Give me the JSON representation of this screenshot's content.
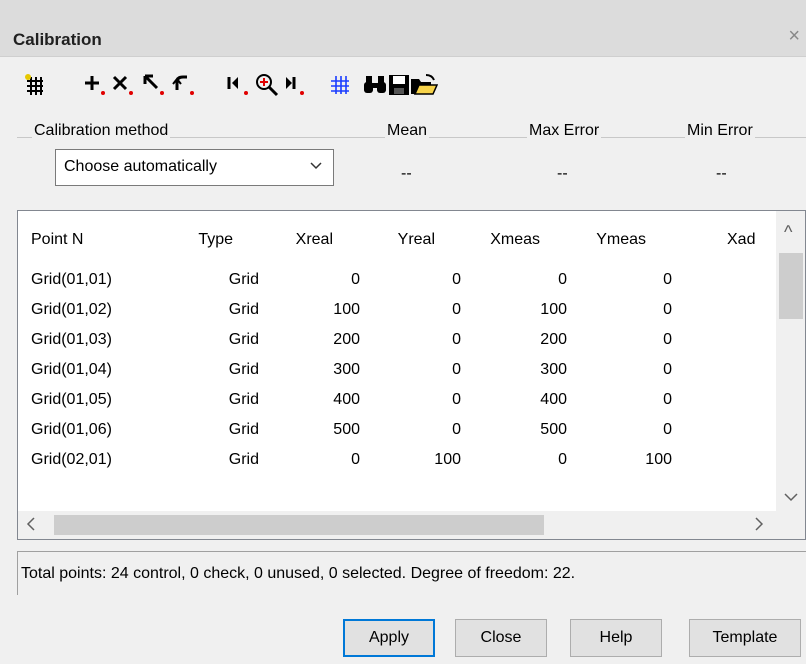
{
  "window": {
    "title": "Calibration",
    "close_glyph": "×"
  },
  "toolbar": {
    "icons": [
      "grid-new-icon",
      "add-point-icon",
      "delete-point-icon",
      "select-arrow-icon",
      "undo-icon",
      "first-point-icon",
      "zoom-point-icon",
      "last-point-icon",
      "grid-overlay-icon",
      "find-icon",
      "save-icon",
      "open-folder-icon"
    ]
  },
  "groups": {
    "method_label": "Calibration method",
    "mean_label": "Mean",
    "max_error_label": "Max Error",
    "min_error_label": "Min Error"
  },
  "method": {
    "selected": "Choose automatically"
  },
  "stats": {
    "mean": "--",
    "max_error": "--",
    "min_error": "--"
  },
  "table": {
    "columns": [
      "Point N",
      "Type",
      "Xreal",
      "Yreal",
      "Xmeas",
      "Ymeas",
      "Xad"
    ],
    "rows": [
      [
        "Grid(01,01)",
        "Grid",
        "0",
        "0",
        "0",
        "0"
      ],
      [
        "Grid(01,02)",
        "Grid",
        "100",
        "0",
        "100",
        "0"
      ],
      [
        "Grid(01,03)",
        "Grid",
        "200",
        "0",
        "200",
        "0"
      ],
      [
        "Grid(01,04)",
        "Grid",
        "300",
        "0",
        "300",
        "0"
      ],
      [
        "Grid(01,05)",
        "Grid",
        "400",
        "0",
        "400",
        "0"
      ],
      [
        "Grid(01,06)",
        "Grid",
        "500",
        "0",
        "500",
        "0"
      ],
      [
        "Grid(02,01)",
        "Grid",
        "0",
        "100",
        "0",
        "100"
      ]
    ]
  },
  "status": {
    "text": "Total points: 24 control, 0 check, 0 unused, 0 selected. Degree of freedom: 22."
  },
  "buttons": {
    "apply": "Apply",
    "close": "Close",
    "help": "Help",
    "template": "Template"
  }
}
